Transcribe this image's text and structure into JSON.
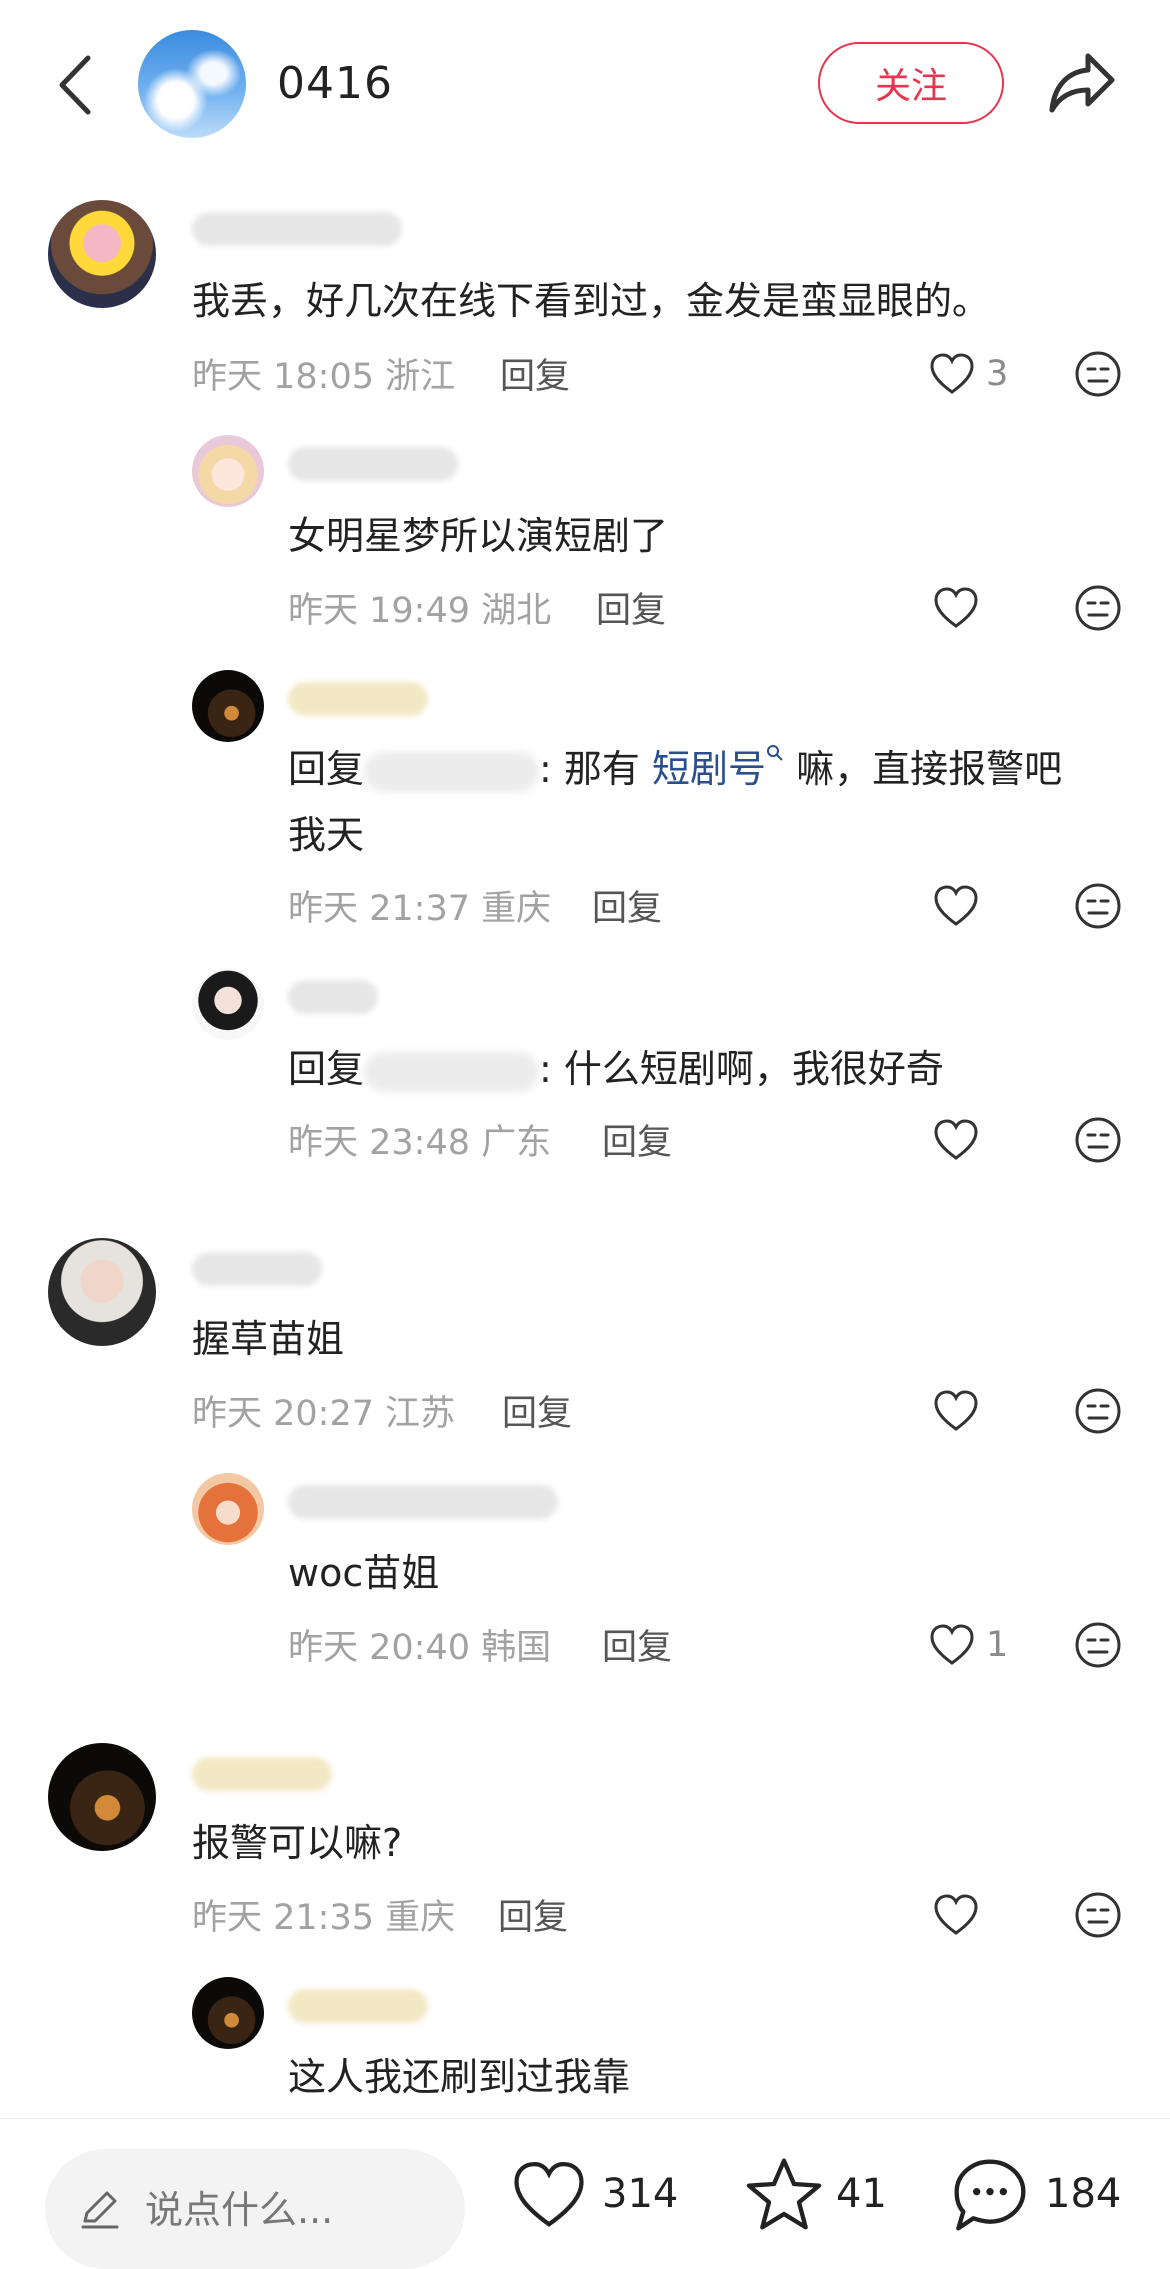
{
  "header": {
    "title": "0416",
    "follow_label": "关注"
  },
  "comments": [
    {
      "text": "我丢，好几次在线下看到过，金发是蛮显眼的。",
      "time": "昨天 18:05",
      "location": "浙江",
      "reply_label": "回复",
      "likes": "3"
    },
    {
      "text": "女明星梦所以演短剧了",
      "time": "昨天 19:49",
      "location": "湖北",
      "reply_label": "回复",
      "likes": ""
    },
    {
      "reply_prefix": "回复",
      "text_a": ": 那有 ",
      "link": "短剧号",
      "text_b": " 嘛，直接报警吧",
      "text_line2": "我天",
      "time": "昨天 21:37",
      "location": "重庆",
      "reply_label": "回复",
      "likes": ""
    },
    {
      "reply_prefix": "回复",
      "text_a": ": 什么短剧啊，我很好奇",
      "time": "昨天 23:48",
      "location": "广东",
      "reply_label": "回复",
      "likes": ""
    },
    {
      "text": "握草苗姐",
      "time": "昨天 20:27",
      "location": "江苏",
      "reply_label": "回复",
      "likes": ""
    },
    {
      "text": "woc苗姐",
      "time": "昨天 20:40",
      "location": "韩国",
      "reply_label": "回复",
      "likes": "1"
    },
    {
      "text": "报警可以嘛?",
      "time": "昨天 21:35",
      "location": "重庆",
      "reply_label": "回复",
      "likes": ""
    },
    {
      "text": "这人我还刷到过我靠"
    }
  ],
  "bottom_bar": {
    "input_placeholder": "说点什么...",
    "like_count": "314",
    "favorite_count": "41",
    "comment_count": "184"
  },
  "colors": {
    "accent": "#e8354f",
    "link": "#2b4e8c",
    "meta": "#a2a2a2"
  }
}
